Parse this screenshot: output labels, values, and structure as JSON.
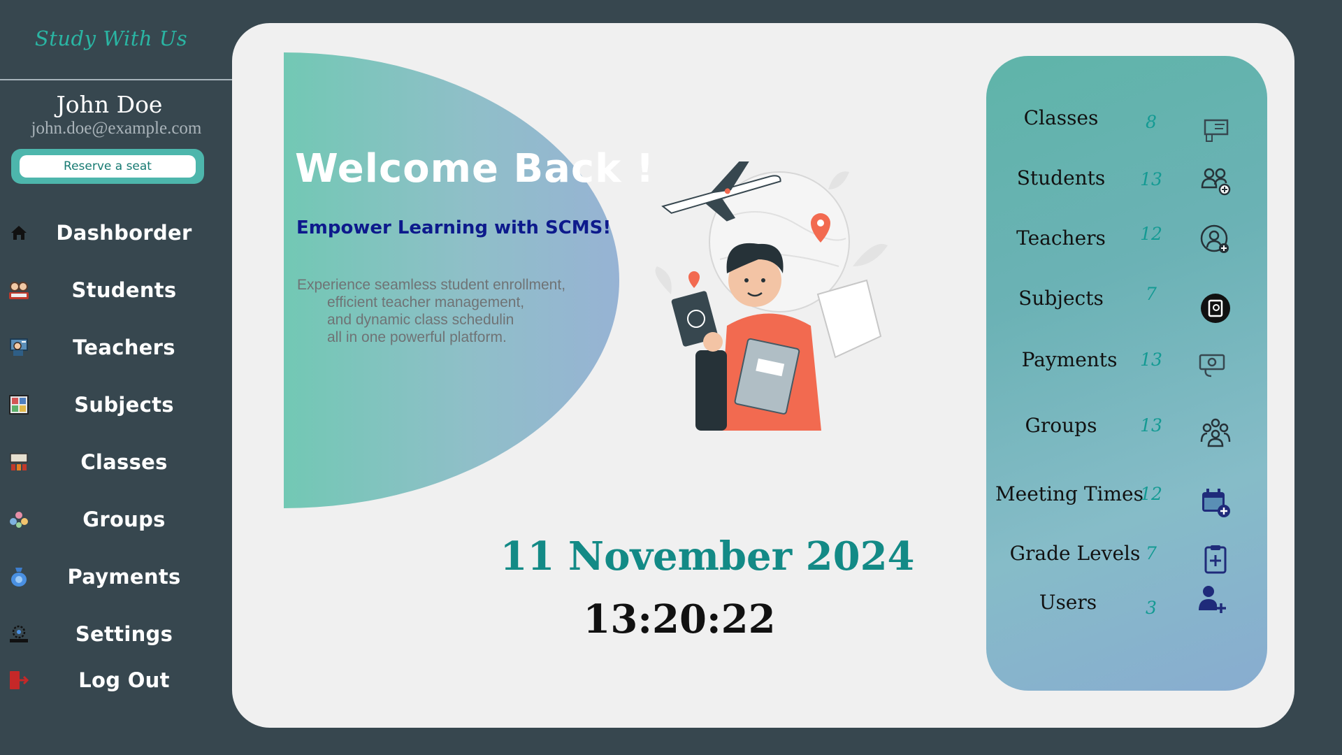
{
  "sidebar": {
    "brand": "Study With Us",
    "user_name": "John Doe",
    "user_email": "john.doe@example.com",
    "reserve_button": "Reserve a seat",
    "items": [
      {
        "label": "Dashborder",
        "icon": "home-icon"
      },
      {
        "label": "Students",
        "icon": "students-icon"
      },
      {
        "label": "Teachers",
        "icon": "teacher-icon"
      },
      {
        "label": "Subjects",
        "icon": "subjects-icon"
      },
      {
        "label": "Classes",
        "icon": "classes-icon"
      },
      {
        "label": "Groups",
        "icon": "groups-icon"
      },
      {
        "label": "Payments",
        "icon": "payments-icon"
      },
      {
        "label": "Settings",
        "icon": "settings-icon"
      },
      {
        "label": "Log Out",
        "icon": "logout-icon"
      }
    ]
  },
  "welcome": {
    "title": "Welcome Back !",
    "subtitle": "Empower Learning with SCMS!",
    "description": [
      "Experience seamless student enrollment,",
      "efficient teacher management,",
      "and dynamic class schedulin",
      "all in one powerful platform."
    ]
  },
  "datetime": {
    "date": "11 November 2024",
    "time": "13:20:22"
  },
  "stats": [
    {
      "label": "Classes",
      "count": "8",
      "icon": "classroom-icon"
    },
    {
      "label": "Students",
      "count": "13",
      "icon": "add-group-icon"
    },
    {
      "label": "Teachers",
      "count": "12",
      "icon": "add-teacher-icon"
    },
    {
      "label": "Subjects",
      "count": "7",
      "icon": "book-icon"
    },
    {
      "label": "Payments",
      "count": "13",
      "icon": "money-icon"
    },
    {
      "label": "Groups",
      "count": "13",
      "icon": "people-group-icon"
    },
    {
      "label": "Meeting Times",
      "count": "12",
      "icon": "add-calendar-icon"
    },
    {
      "label": "Grade Levels",
      "count": "7",
      "icon": "clipboard-plus-icon"
    },
    {
      "label": "Users",
      "count": "3",
      "icon": "add-user-icon"
    }
  ],
  "colors": {
    "background": "#37474f",
    "accent": "#2ab5a3",
    "panel": "#f0f0f0",
    "date": "#138a86",
    "subtitle": "#0d1a8c"
  }
}
